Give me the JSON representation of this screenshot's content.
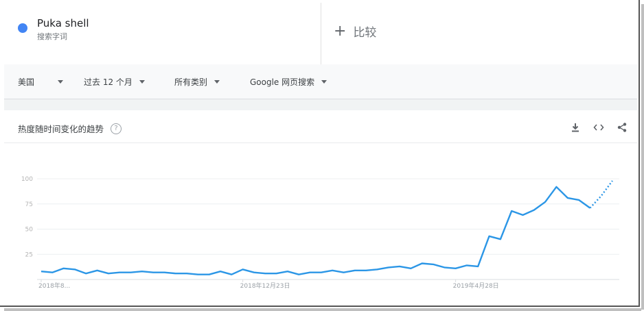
{
  "search_term": {
    "name": "Puka shell",
    "subtitle": "搜索字词"
  },
  "compare": {
    "label": "比较"
  },
  "filters": [
    {
      "label": "美国"
    },
    {
      "label": "过去 12 个月"
    },
    {
      "label": "所有类别"
    },
    {
      "label": "Google 网页搜索"
    }
  ],
  "card": {
    "title": "热度随时间变化的趋势"
  },
  "colors": {
    "series": "#2b96e6",
    "term_dot": "#4285f4"
  },
  "chart_data": {
    "type": "line",
    "title": "热度随时间变化的趋势",
    "yticks": [
      "100",
      "75",
      "50",
      "25"
    ],
    "ylim": [
      0,
      100
    ],
    "xtick_labels": [
      "2018年8...",
      "2018年12月23日",
      "2019年4月28日"
    ],
    "xtick_indices": [
      0,
      18,
      37
    ],
    "series": [
      {
        "values": [
          8,
          7,
          11,
          10,
          6,
          9,
          6,
          7,
          7,
          8,
          7,
          7,
          6,
          6,
          5,
          5,
          8,
          5,
          10,
          7,
          6,
          6,
          8,
          5,
          7,
          7,
          9,
          7,
          9,
          9,
          10,
          12,
          13,
          11,
          16,
          15,
          12,
          11,
          14,
          13,
          43,
          40,
          68,
          64,
          69,
          77,
          92,
          81,
          79,
          71,
          83,
          98
        ],
        "partial_last": 2
      }
    ],
    "grid": true
  }
}
